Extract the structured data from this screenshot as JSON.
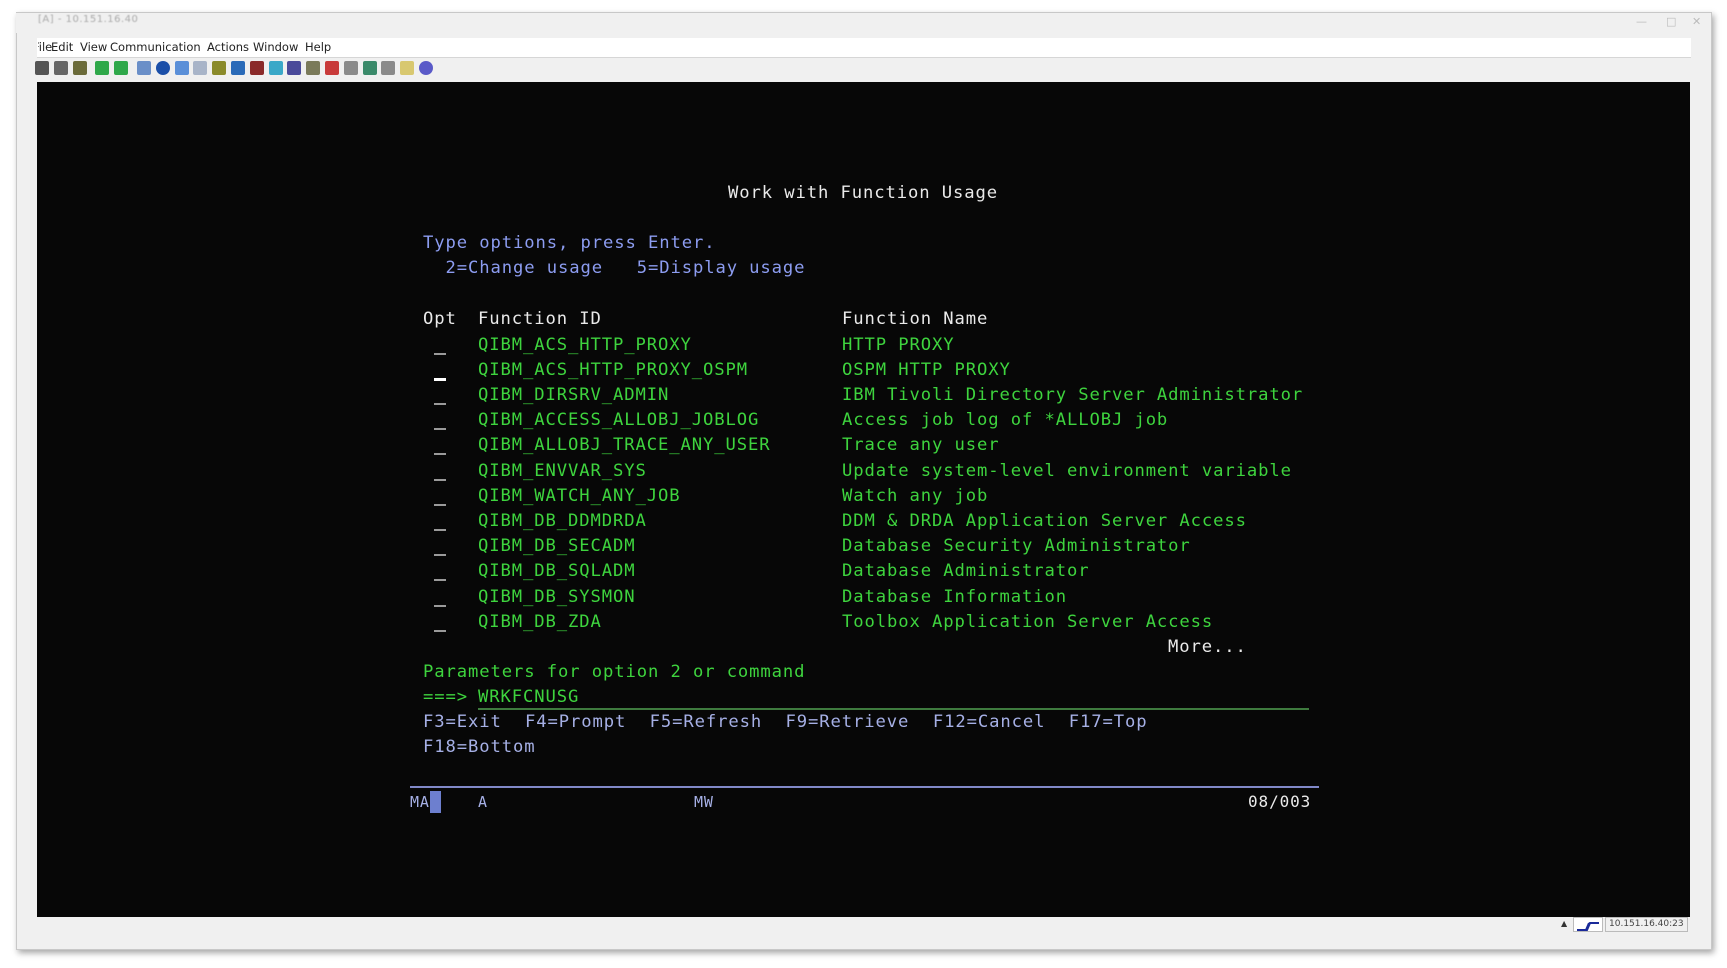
{
  "window": {
    "title": "[A] - 10.151.16.40",
    "controls": [
      "—",
      "□",
      "✕"
    ]
  },
  "menubar": {
    "items": [
      "File",
      "Edit",
      "View",
      "Communication",
      "Actions",
      "Window",
      "Help"
    ]
  },
  "toolbar": {
    "icons": [
      {
        "name": "print-icon",
        "color": "#555555"
      },
      {
        "name": "copy-icon",
        "color": "#666666"
      },
      {
        "name": "paste-icon",
        "color": "#6b6b3a"
      },
      {
        "name": "send-file-icon",
        "color": "#2fa84a"
      },
      {
        "name": "receive-file-icon",
        "color": "#2fa84a"
      },
      {
        "name": "display-icon",
        "color": "#6a8fc8"
      },
      {
        "name": "record-macro-icon",
        "color": "#1b4fa8"
      },
      {
        "name": "window-icon",
        "color": "#5a8fd8"
      },
      {
        "name": "document-icon",
        "color": "#a8b4c8"
      },
      {
        "name": "database-icon",
        "color": "#8a8a2a"
      },
      {
        "name": "settings-gear-icon",
        "color": "#2a6ab8"
      },
      {
        "name": "session-icon",
        "color": "#8a2a2a"
      },
      {
        "name": "screen-icon",
        "color": "#3aa8c8"
      },
      {
        "name": "grid-icon",
        "color": "#4a4a9a"
      },
      {
        "name": "tools-icon",
        "color": "#7a7a5a"
      },
      {
        "name": "upload-red-icon",
        "color": "#c83a3a"
      },
      {
        "name": "printer-small-icon",
        "color": "#8a8a8a"
      },
      {
        "name": "flag-icon",
        "color": "#3a8a6a"
      },
      {
        "name": "pause-icon",
        "color": "#8a8a8a"
      },
      {
        "name": "notes-icon",
        "color": "#d8c870"
      },
      {
        "name": "help-icon",
        "color": "#5a5ac8"
      }
    ]
  },
  "screen": {
    "title": "Work with Function Usage",
    "instructions": "Type options, press Enter.",
    "options": "  2=Change usage   5=Display usage",
    "headers": {
      "opt": "Opt",
      "function_id": "Function ID",
      "function_name": "Function Name"
    },
    "rows": [
      {
        "id": "QIBM_ACS_HTTP_PROXY",
        "name": "HTTP PROXY",
        "active": false
      },
      {
        "id": "QIBM_ACS_HTTP_PROXY_OSPM",
        "name": "OSPM HTTP PROXY",
        "active": true
      },
      {
        "id": "QIBM_DIRSRV_ADMIN",
        "name": "IBM Tivoli Directory Server Administrator",
        "active": false
      },
      {
        "id": "QIBM_ACCESS_ALLOBJ_JOBLOG",
        "name": "Access job log of *ALLOBJ job",
        "active": false
      },
      {
        "id": "QIBM_ALLOBJ_TRACE_ANY_USER",
        "name": "Trace any user",
        "active": false
      },
      {
        "id": "QIBM_ENVVAR_SYS",
        "name": "Update system-level environment variable",
        "active": false
      },
      {
        "id": "QIBM_WATCH_ANY_JOB",
        "name": "Watch any job",
        "active": false
      },
      {
        "id": "QIBM_DB_DDMDRDA",
        "name": "DDM & DRDA Application Server Access",
        "active": false
      },
      {
        "id": "QIBM_DB_SECADM",
        "name": "Database Security Administrator",
        "active": false
      },
      {
        "id": "QIBM_DB_SQLADM",
        "name": "Database Administrator",
        "active": false
      },
      {
        "id": "QIBM_DB_SYSMON",
        "name": "Database Information",
        "active": false
      },
      {
        "id": "QIBM_DB_ZDA",
        "name": "Toolbox Application Server Access",
        "active": false
      }
    ],
    "more": "More...",
    "params_label": "Parameters for option 2 or command",
    "prompt": "===>",
    "command_value": "WRKFCNUSG",
    "fkeys_line1": [
      "F3=Exit",
      "F4=Prompt",
      "F5=Refresh",
      "F9=Retrieve",
      "F12=Cancel",
      "F17=Top"
    ],
    "fkeys_line2": [
      "F18=Bottom"
    ]
  },
  "oia": {
    "session": "MA",
    "indicator": "A",
    "mode": "MW",
    "cursor_position": "08/003"
  },
  "statusbar": {
    "scroll_indicator": "▲",
    "connection_icon": "connection-status-icon",
    "host": "10.151.16.40:23"
  },
  "colors": {
    "background": "#070707",
    "white_text": "#eaeaea",
    "green_text": "#3ed43e",
    "blue_text": "#8c9cf0",
    "fkey_text": "#a6b0e6",
    "cursor": "#7f94f2"
  }
}
